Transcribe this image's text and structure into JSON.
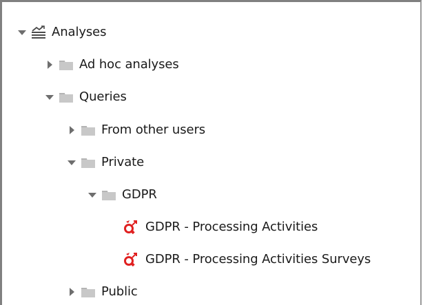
{
  "tree": {
    "analyses": {
      "label": "Analyses",
      "expanded": true,
      "icon": "analyses-icon",
      "children": {
        "ad_hoc": {
          "label": "Ad hoc analyses",
          "expanded": false,
          "icon": "folder-icon"
        },
        "queries": {
          "label": "Queries",
          "expanded": true,
          "icon": "folder-icon",
          "children": {
            "from_other_users": {
              "label": "From other users",
              "expanded": false,
              "icon": "folder-icon"
            },
            "private": {
              "label": "Private",
              "expanded": true,
              "icon": "folder-icon",
              "children": {
                "gdpr": {
                  "label": "GDPR",
                  "expanded": true,
                  "icon": "folder-icon",
                  "children": [
                    {
                      "label": "GDPR - Processing Activities",
                      "icon": "query-icon"
                    },
                    {
                      "label": "GDPR - Processing Activities Surveys",
                      "icon": "query-icon"
                    }
                  ]
                }
              }
            },
            "public": {
              "label": "Public",
              "expanded": false,
              "icon": "folder-icon"
            }
          }
        }
      }
    }
  },
  "colors": {
    "folder": "#c8c8c8",
    "folder_tab": "#b4b4b4",
    "toggle": "#6e6e6e",
    "query_red": "#e02020",
    "text": "#1a1a1a",
    "border": "#808080"
  }
}
